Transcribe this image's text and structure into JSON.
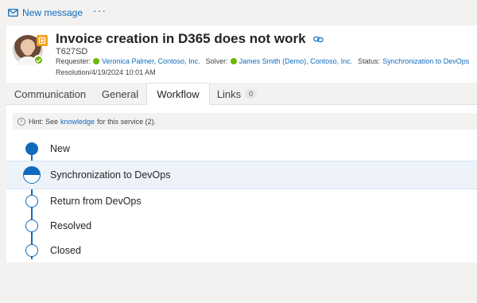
{
  "commandbar": {
    "new_message_label": "New message",
    "more_label": "···"
  },
  "ticket": {
    "title": "Invoice creation in D365 does not work",
    "id": "T627SD",
    "requester_label": "Requester:",
    "requester": "Veronica Palmer, Contoso, Inc.",
    "solver_label": "Solver:",
    "solver": "James Smith (Demo), Contoso, Inc.",
    "status_label": "Status:",
    "status": "Synchronization to DevOps",
    "resolution": "Resolution/4/19/2024 10:01 AM"
  },
  "tabs": [
    {
      "label": "Communication"
    },
    {
      "label": "General"
    },
    {
      "label": "Workflow"
    },
    {
      "label": "Links",
      "badge": "0"
    }
  ],
  "hint": {
    "prefix": "Hint: See",
    "link": "knowledge",
    "suffix": "for this service (2)."
  },
  "workflow": {
    "steps": [
      {
        "label": "New",
        "state": "done"
      },
      {
        "label": "Synchronization to DevOps",
        "state": "current"
      },
      {
        "label": "Return from DevOps",
        "state": "pending"
      },
      {
        "label": "Resolved",
        "state": "pending"
      },
      {
        "label": "Closed",
        "state": "pending"
      }
    ]
  },
  "colors": {
    "accent": "#0f6cbd",
    "success": "#6bb700",
    "ticket_type": "#f7a11a"
  },
  "icons": {
    "new_message": "mail-icon",
    "link": "link-icon",
    "info": "info-icon",
    "check": "check-icon"
  }
}
